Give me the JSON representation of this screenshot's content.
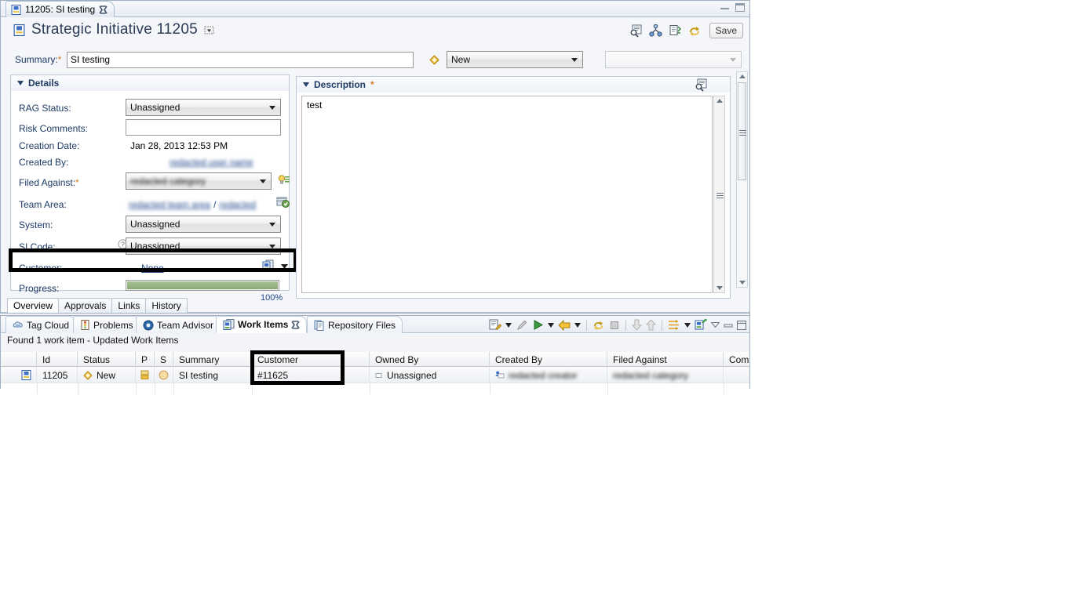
{
  "window": {
    "minimize_label": "minimize",
    "maximize_label": "maximize"
  },
  "editor": {
    "tab": {
      "label": "11205: SI testing",
      "icon": "work-item-icon",
      "close_icon": "close-icon"
    },
    "title": "Strategic Initiative 11205",
    "title_icon": "work-item-icon",
    "title_menu_icon": "dropdown-menu-icon",
    "toolbar": [
      {
        "name": "open-in-browser-icon",
        "label": "Open in Browser"
      },
      {
        "name": "show-links-icon",
        "label": "Show Links"
      },
      {
        "name": "history-icon",
        "label": "History"
      },
      {
        "name": "refresh-icon",
        "label": "Refresh"
      }
    ],
    "save_label": "Save",
    "summary": {
      "label": "Summary:",
      "required": "*",
      "value": "SI testing"
    },
    "state": {
      "icon": "state-diamond-icon",
      "value": "New",
      "action_value": ""
    }
  },
  "details": {
    "header": "Details",
    "rows": [
      {
        "label": "RAG Status:",
        "type": "combo",
        "value": "Unassigned"
      },
      {
        "label": "Risk Comments:",
        "type": "text",
        "value": ""
      },
      {
        "label": "Creation Date:",
        "type": "static",
        "value": "Jan 28, 2013 12:53 PM"
      },
      {
        "label": "Created By:",
        "type": "blurlink",
        "value": "redacted user name"
      },
      {
        "label": "Filed Against:",
        "type": "blurcombo",
        "value": "redacted category",
        "required": "*",
        "icon": "pick-value-icon"
      },
      {
        "label": "Team Area:",
        "type": "blurpath",
        "value": "redacted team area",
        "separator": "/",
        "value2": "redacted",
        "icon": "team-area-icon"
      },
      {
        "label": "System:",
        "type": "combo",
        "value": "Unassigned"
      },
      {
        "label": "SI Code:",
        "type": "combo",
        "value": "Unassigned",
        "help_icon": "help-icon"
      },
      {
        "label": "Customer:",
        "type": "link",
        "value": "None",
        "icon": "customer-picker-icon",
        "menu_icon": "chevron-down-icon",
        "highlighted": true
      },
      {
        "label": "Progress:",
        "type": "progress",
        "value": "100%",
        "percent": 100
      }
    ]
  },
  "description": {
    "header": "Description",
    "required": "*",
    "maximize_icon": "open-editor-icon",
    "body": "test"
  },
  "form_tabs": [
    {
      "label": "Overview",
      "selected": true
    },
    {
      "label": "Approvals",
      "selected": false
    },
    {
      "label": "Links",
      "selected": false
    },
    {
      "label": "History",
      "selected": false
    }
  ],
  "views": {
    "tabs": [
      {
        "label": "Tag Cloud",
        "icon": "tag-cloud-icon",
        "selected": false,
        "closable": false
      },
      {
        "label": "Problems",
        "icon": "problems-icon",
        "selected": false,
        "closable": false
      },
      {
        "label": "Team Advisor",
        "icon": "team-advisor-icon",
        "selected": false,
        "closable": false
      },
      {
        "label": "Work Items",
        "icon": "work-items-icon",
        "selected": true,
        "closable": true
      },
      {
        "label": "Repository Files",
        "icon": "repo-files-icon",
        "selected": false,
        "closable": false
      }
    ],
    "toolbar": [
      {
        "name": "new-query-icon",
        "label": "New Query"
      },
      {
        "name": "new-query-menu-icon",
        "label": "New Query Menu"
      },
      {
        "name": "edit-icon",
        "label": "Edit"
      },
      {
        "name": "run-icon",
        "label": "Run"
      },
      {
        "name": "run-menu-icon",
        "label": "Run Menu"
      },
      {
        "name": "back-icon",
        "label": "Back"
      },
      {
        "name": "back-menu-icon",
        "label": "Back Menu"
      },
      {
        "name": "refresh-icon",
        "label": "Refresh"
      },
      {
        "name": "stop-icon",
        "label": "Stop"
      },
      {
        "name": "next-icon",
        "label": "Next"
      },
      {
        "name": "previous-icon",
        "label": "Previous"
      },
      {
        "name": "group-icon",
        "label": "Group"
      },
      {
        "name": "group-menu-icon",
        "label": "Group Menu"
      },
      {
        "name": "new-work-item-icon",
        "label": "New Work Item"
      },
      {
        "name": "view-menu-icon",
        "label": "View Menu"
      },
      {
        "name": "minimize-view-icon",
        "label": "Minimize"
      },
      {
        "name": "maximize-view-icon",
        "label": "Maximize"
      }
    ],
    "status": "Found 1 work item - Updated Work Items",
    "table": {
      "columns": [
        {
          "key": "id",
          "label": "Id"
        },
        {
          "key": "status",
          "label": "Status"
        },
        {
          "key": "p",
          "label": "P"
        },
        {
          "key": "s",
          "label": "S"
        },
        {
          "key": "summary",
          "label": "Summary"
        },
        {
          "key": "customer",
          "label": "Customer",
          "highlighted": true
        },
        {
          "key": "owned_by",
          "label": "Owned By"
        },
        {
          "key": "created_by",
          "label": "Created By"
        },
        {
          "key": "filed_against",
          "label": "Filed Against"
        },
        {
          "key": "com",
          "label": "Com"
        }
      ],
      "rows": [
        {
          "icon": "work-item-icon",
          "id": "11205",
          "status": "New",
          "status_icon": "state-diamond-icon",
          "p": "priority-medium-icon",
          "s": "severity-normal-icon",
          "summary": "SI testing",
          "customer": "#11625",
          "owned_by": "Unassigned",
          "owned_by_icon": "unassigned-user-icon",
          "created_by": "redacted creator",
          "created_by_icon": "user-icon",
          "filed_against": "redacted category",
          "com": ""
        }
      ]
    }
  },
  "colors": {
    "title_blue": "#2b3c56",
    "label_blue": "#1d3a66",
    "link_blue": "#20478c",
    "required_orange": "#d07b20",
    "progress_green": "#89a872",
    "highlight_black": "#000000"
  }
}
